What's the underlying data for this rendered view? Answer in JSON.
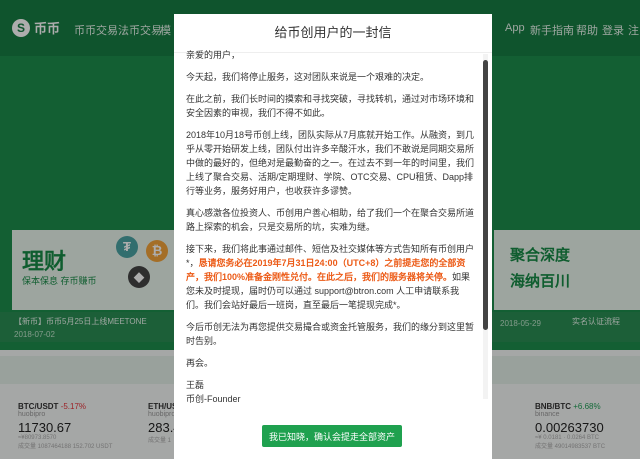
{
  "nav": {
    "brand": "币币",
    "items": [
      "币币交易",
      "法币交易",
      "模"
    ],
    "right_items": [
      "App",
      "新手指南",
      "帮助",
      "登录",
      "注"
    ]
  },
  "banners": {
    "left_title": "理财",
    "left_sub": "保本保息 存币赚币",
    "right_line1": "聚合深度",
    "right_line2": "海纳百川"
  },
  "news": [
    {
      "text": "【新币】币币5月25日上线MEETONE",
      "date": "2018-07-02"
    },
    {
      "text": "",
      "date": "2018-05-29"
    },
    {
      "text": "实名认证流程",
      "date": ""
    }
  ],
  "tickers": [
    {
      "pair": "BTC/USDT",
      "change": "-5.17%",
      "exchange": "huobipro",
      "price": "11730.67",
      "sub": "≈¥80973.8570",
      "sub2": "成交量 1087464188 152.702 USDT"
    },
    {
      "pair": "ETH/USD",
      "change": "",
      "exchange": "huobipro",
      "price": "283.4",
      "sub": "",
      "sub2": "成交量 1"
    },
    {
      "pair": "BNB/BTC",
      "change": "+6.68%",
      "exchange": "binance",
      "price": "0.00263730",
      "sub": "≈¥ 0.0181 · 0.0264 BTC",
      "sub2": "成交量 49014983537 BTC"
    }
  ],
  "modal": {
    "title": "给币创用户的一封信",
    "greeting": "亲爱的用户，",
    "p1": "今天起，我们将停止服务，这对团队来说是一个艰难的决定。",
    "p2": "在此之前，我们长时间的摸索和寻找突破，寻找转机，通过对市场环境和安全因素的审视，我们不得不如此。",
    "p3": "2018年10月18号币创上线，团队实际从7月底就开始工作。从融资，到几乎从零开始研发上线，团队付出许多辛酸汗水，我们不敢说是同期交易所中做的最好的，但绝对是最勤奋的之一。在过去不到一年的时间里，我们上线了聚合交易、活期/定期理财、学院、OTC交易、CPU租赁、Dapp排行等业务，服务好用户，也收获许多谬赞。",
    "p4": "真心感激各位投资人、币创用户善心相助，给了我们一个在聚合交易所道路上探索的机会，只是交易所的坑，实难为继。",
    "p5_a": "接下来，我们将此事通过邮件、短信及社交媒体等方式告知所有币创用户*，",
    "p5_hl": "恳请您务必在2019年7月31日24:00（UTC+8）之前提走您的全部资产，我们100%准备金刚性兑付。在此之后，我们的服务器将关停。",
    "p5_b": "如果您未及时提现，届时仍可以通过 support@btron.com 人工申请联系我们。我们会站好最后一班岗，直至最后一笔提现完成*。",
    "p6": "今后币创无法为再您提供交易撮合或资金托管服务，我们的缘分到这里暂时告别。",
    "p7": "再会。",
    "signer": "王磊",
    "signer_title": "币创-Founder",
    "confirm_label": "我已知晓，确认会提走全部资产"
  }
}
